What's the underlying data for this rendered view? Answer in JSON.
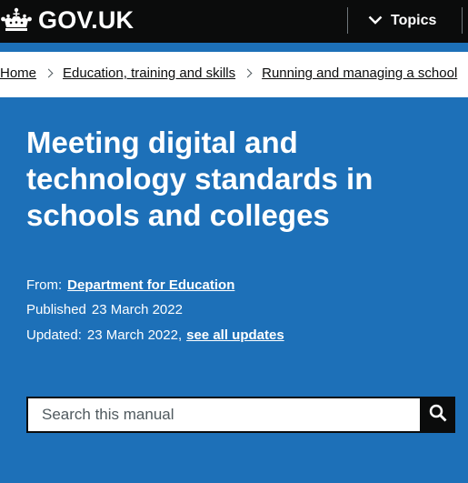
{
  "header": {
    "logo_text": "GOV.UK",
    "topics_label": "Topics",
    "colors": {
      "background": "#0b0c0c",
      "text": "#ffffff"
    },
    "icons": {
      "logo": "crown-icon",
      "topics": "chevron-down-icon"
    }
  },
  "breadcrumbs": {
    "items": [
      {
        "label": "Home"
      },
      {
        "label": "Education, training and skills"
      },
      {
        "label": "Running and managing a school"
      }
    ],
    "separator_icon": "chevron-right-icon"
  },
  "hero": {
    "background": "#1d70b8",
    "title": "Meeting digital and technology standards in schools and colleges",
    "from_label": "From:",
    "from_value": "Department for Education",
    "published_label": "Published",
    "published_value": "23 March 2022",
    "updated_label": "Updated:",
    "updated_value": "23 March 2022,",
    "updates_link": "see all updates"
  },
  "search": {
    "placeholder": "Search this manual",
    "button_icon": "search-icon"
  }
}
